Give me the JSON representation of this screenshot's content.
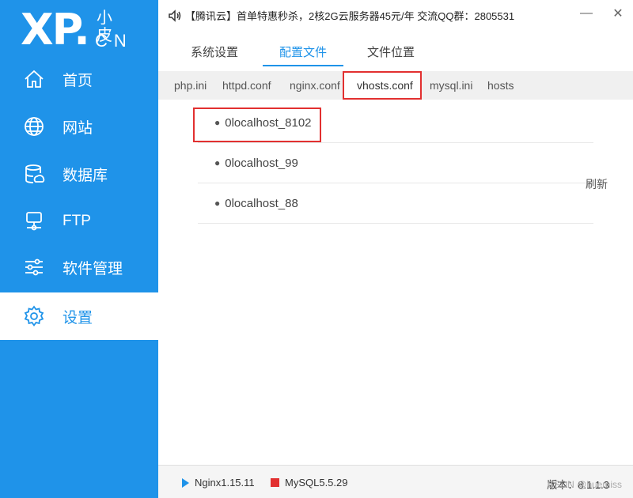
{
  "logo": {
    "main": "XP.",
    "small": "小皮",
    "domain": "CN"
  },
  "sidebar": {
    "items": [
      {
        "label": "首页",
        "icon": "home-icon"
      },
      {
        "label": "网站",
        "icon": "globe-icon"
      },
      {
        "label": "数据库",
        "icon": "database-icon"
      },
      {
        "label": "FTP",
        "icon": "ftp-server-icon"
      },
      {
        "label": "软件管理",
        "icon": "sliders-icon"
      },
      {
        "label": "设置",
        "icon": "gear-icon"
      }
    ],
    "active_index": 5
  },
  "titlebar": {
    "notice": "【腾讯云】首单特惠秒杀，2核2G云服务器45元/年 交流QQ群：2805531",
    "minimize_icon": "minimize-icon",
    "close_icon": "close-icon"
  },
  "tabs": [
    {
      "label": "系统设置"
    },
    {
      "label": "配置文件"
    },
    {
      "label": "文件位置"
    }
  ],
  "active_tab": 1,
  "subtabs": [
    {
      "label": "php.ini"
    },
    {
      "label": "httpd.conf"
    },
    {
      "label": "nginx.conf"
    },
    {
      "label": "vhosts.conf"
    },
    {
      "label": "mysql.ini"
    },
    {
      "label": "hosts"
    }
  ],
  "active_subtab": 3,
  "files": [
    {
      "bullet": "●",
      "name": "0localhost_8102"
    },
    {
      "bullet": "●",
      "name": "0localhost_99"
    },
    {
      "bullet": "●",
      "name": "0localhost_88"
    }
  ],
  "refresh_label": "刷新",
  "status": {
    "nginx": "Nginx1.15.11",
    "mysql": "MySQL5.5.29",
    "version": "版本：8.1.1.3",
    "watermark": "CSDN @huemiss"
  },
  "colors": {
    "accent": "#1f93e9",
    "highlight": "#e23030"
  }
}
